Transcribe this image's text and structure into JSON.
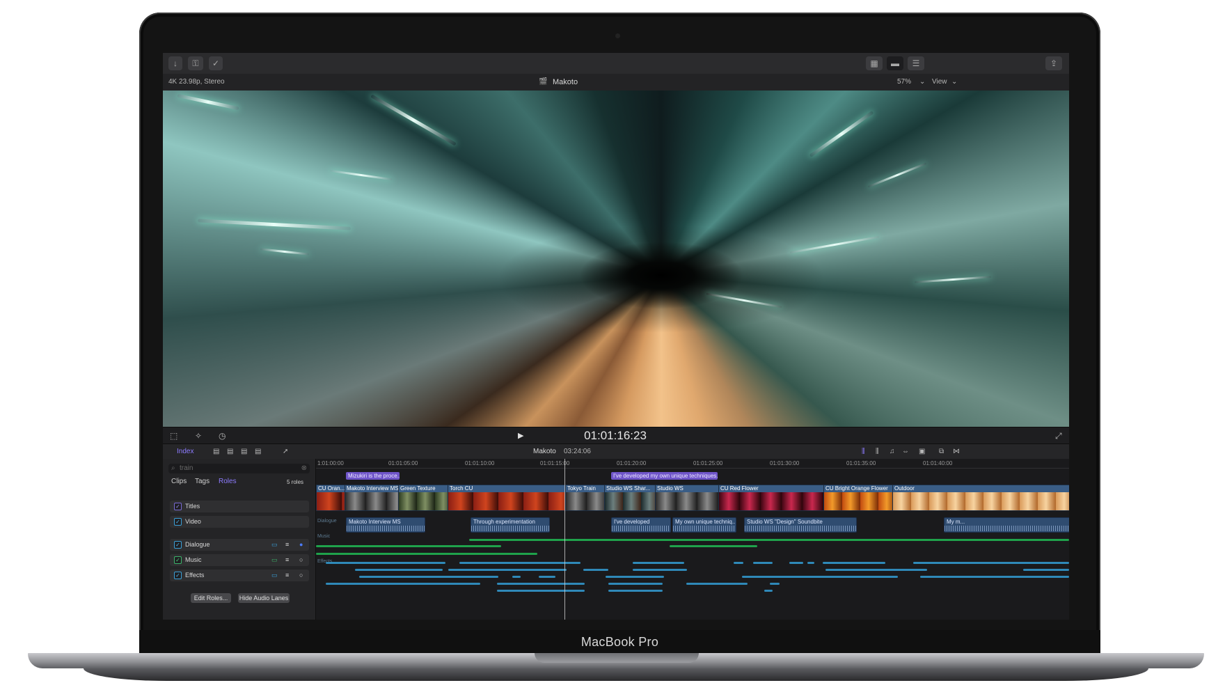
{
  "device": {
    "label": "MacBook Pro"
  },
  "toolbar": {
    "left_icons": [
      "import-icon",
      "keyword-icon",
      "checkmark-icon"
    ],
    "right_icons": [
      "browser-grid-icon",
      "timeline-icon",
      "inspector-icon",
      "share-icon"
    ]
  },
  "viewer": {
    "format": "4K 23.98p, Stereo",
    "project_title": "Makoto",
    "zoom": "57%",
    "view_menu": "View"
  },
  "transport": {
    "timecode": "01:01:16:23"
  },
  "timeline_toolbar": {
    "index_tab": "Index",
    "project_name": "Makoto",
    "duration": "03:24:06"
  },
  "index_panel": {
    "search_value": "train",
    "tabs": [
      "Clips",
      "Tags",
      "Roles"
    ],
    "active_tab": "Roles",
    "roles_count": "5 roles",
    "roles": [
      {
        "name": "Titles",
        "color": "#7a6bd6"
      },
      {
        "name": "Video",
        "color": "#3aa0d8"
      },
      {
        "name": "Dialogue",
        "color": "#3aa0d8"
      },
      {
        "name": "Music",
        "color": "#3bb36a"
      },
      {
        "name": "Effects",
        "color": "#3aa0d8"
      }
    ],
    "edit_roles_button": "Edit Roles...",
    "hide_lanes_button": "Hide Audio Lanes"
  },
  "timeline": {
    "ruler_ticks": [
      "1:01:00:00",
      "01:01:05:00",
      "01:01:10:00",
      "01:01:15:00",
      "01:01:20:00",
      "01:01:25:00",
      "01:01:30:00",
      "01:01:35:00",
      "01:01:40:00"
    ],
    "title_clips": [
      "Mizukiri is the proce...",
      "I've developed my own unique techniques."
    ],
    "video_clips": [
      "CU Oran...",
      "Makoto Interview MS",
      "Green Texture",
      "Torch CU",
      "Tokyo Train",
      "Studio WS Shar...",
      "Studio WS",
      "CU Red Flower",
      "CU Bright Orange Flower",
      "Outdoor"
    ],
    "audio_clips": [
      "Makoto Interview MS",
      "Through experimentation",
      "I've developed",
      "My own unique techniq...",
      "Studio WS \"Design\" Soundbite",
      "My m..."
    ],
    "lane_labels": [
      "Dialogue",
      "Music",
      "Effects"
    ]
  },
  "colors": {
    "title_clip": "#6f55c9",
    "video_clip": "#3a5d86",
    "music_lane": "#1fa24b",
    "effects_lane": "#2f89b8"
  }
}
